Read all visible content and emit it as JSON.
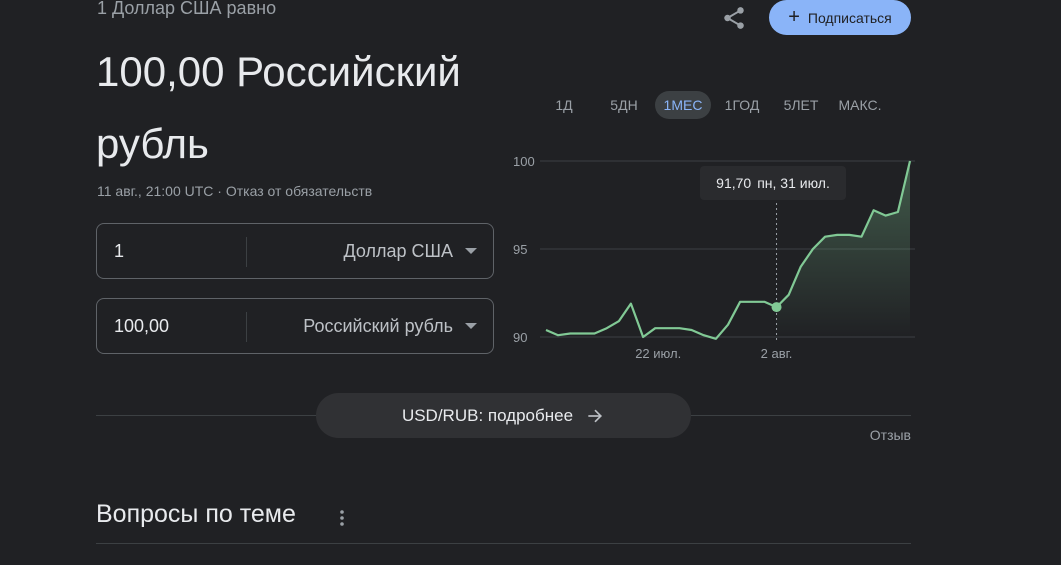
{
  "header": {
    "subtitle": "1 Доллар США равно",
    "value": "100,00 Российский рубль",
    "timestamp": "11 авг., 21:00 UTC · Отказ от обязательств",
    "subscribe_label": "Подписаться"
  },
  "converter": {
    "from_amount": "1",
    "from_currency": "Доллар США",
    "to_amount": "100,00",
    "to_currency": "Российский рубль"
  },
  "ranges": [
    "1Д",
    "5ДН",
    "1МЕС",
    "1ГОД",
    "5ЛЕТ",
    "МАКС."
  ],
  "active_range": "1МЕС",
  "tooltip": {
    "value": "91,70",
    "date": "пн, 31 июл."
  },
  "chart_data": {
    "type": "area",
    "y_ticks": [
      100,
      95,
      90
    ],
    "x_ticks": [
      "22 июл.",
      "2 авг."
    ],
    "ylim": [
      90,
      100
    ],
    "x": [
      1,
      2,
      3,
      4,
      5,
      6,
      7,
      8,
      9,
      10,
      11,
      12,
      13,
      14,
      15,
      16,
      17,
      18,
      19,
      20,
      21,
      22,
      23,
      24,
      25,
      26,
      27,
      28,
      29,
      30,
      31,
      32
    ],
    "values": [
      90.4,
      90.1,
      90.2,
      90.2,
      90.2,
      90.5,
      90.9,
      91.9,
      90.0,
      90.5,
      90.5,
      90.5,
      90.4,
      90.1,
      89.9,
      90.7,
      92.0,
      92.0,
      92.0,
      91.7,
      92.4,
      94.0,
      95.0,
      95.7,
      95.8,
      95.8,
      95.7,
      97.2,
      96.9,
      97.1,
      100.0
    ],
    "highlight_index": 19,
    "line_color": "#81c995",
    "grid": true
  },
  "details_label": "USD/RUB: подробнее",
  "feedback_label": "Отзыв",
  "section_title": "Вопросы по теме",
  "icons": {
    "share": "share-icon",
    "plus": "plus-icon",
    "arrow": "arrow-right-icon",
    "more": "more-vert-icon"
  }
}
